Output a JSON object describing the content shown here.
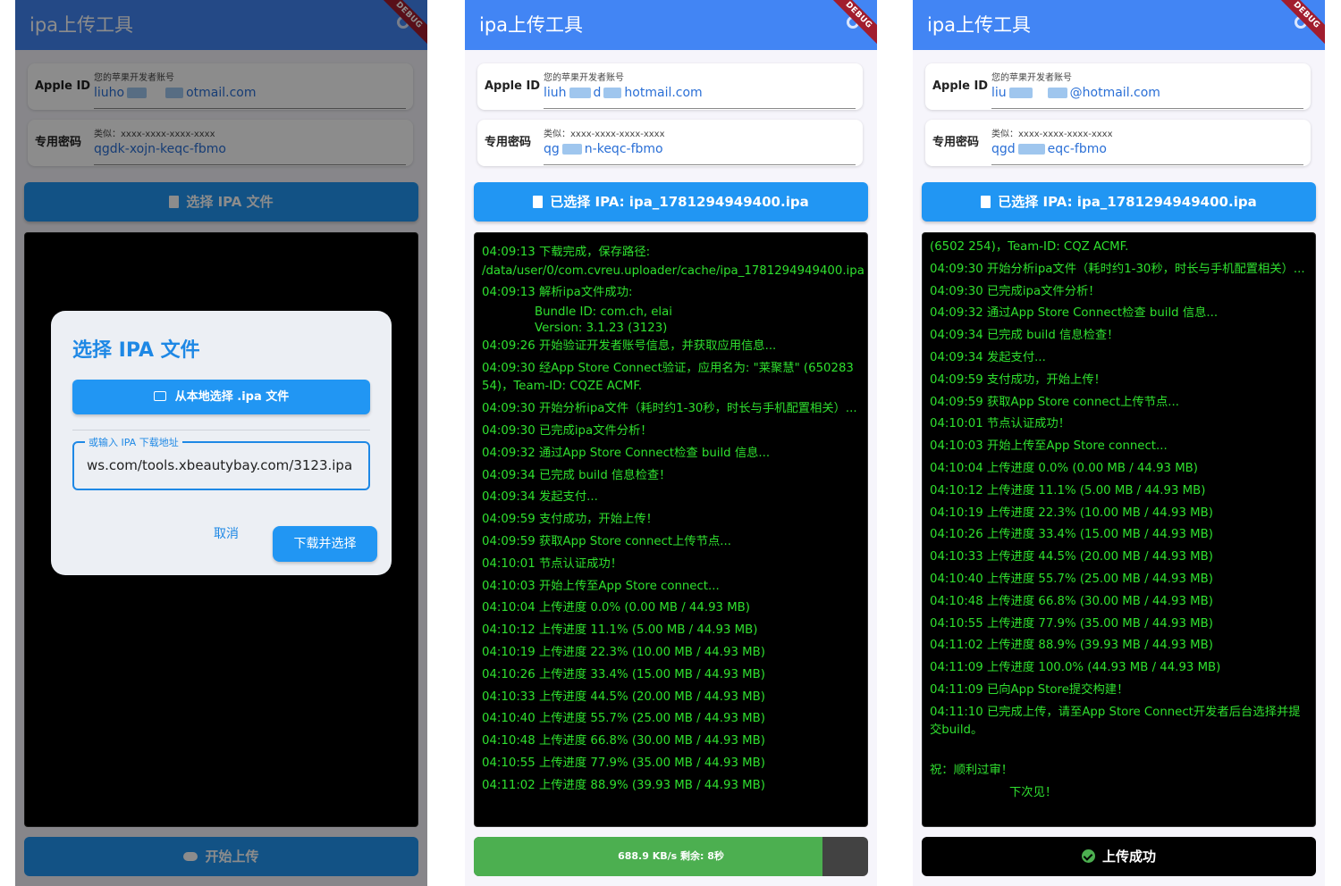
{
  "app": {
    "title": "ipa上传工具",
    "debug_label": "DEBUG"
  },
  "form": {
    "apple_id_label": "Apple ID",
    "apple_id_hint": "您的苹果开发者账号",
    "password_label": "专用密码",
    "password_hint": "类似：xxxx-xxxx-xxxx-xxxx"
  },
  "screen1": {
    "apple_id_a": "liuho",
    "apple_id_b": "otmail.com",
    "password_value": "qgdk-xojn-keqc-fbmo",
    "select_button": "选择 IPA 文件",
    "upload_button": "开始上传",
    "dialog": {
      "title": "选择 IPA 文件",
      "local_button": "从本地选择 .ipa 文件",
      "url_label": "或输入 IPA 下载地址",
      "url_value": "ws.com/tools.xbeautybay.com/3123.ipa",
      "cancel": "取消",
      "download": "下载并选择"
    }
  },
  "screen2": {
    "apple_id_a": "liuh",
    "apple_id_b": "d",
    "apple_id_c": "hotmail.com",
    "password_a": "qg",
    "password_b": "n-keqc-fbmo",
    "select_button": "已选择 IPA: ipa_1781294949400.ipa",
    "progress_text": "688.9 KB/s 剩余: 8秒",
    "progress_fraction": 0.885,
    "logs": [
      "04:09:13 下载完成，保存路径: /data/user/0/com.cvreu.uploader/cache/ipa_1781294949400.ipa",
      "04:09:13 解析ipa文件成功:",
      "Bundle ID: com.ch,   elai",
      "Version: 3.1.23 (3123)",
      "04:09:26 开始验证开发者账号信息，并获取应用信息...",
      "04:09:30 经App Store Connect验证，应用名为: \"莱聚慧\" (650283      54)，Team-ID: CQZE     ACMF.",
      "04:09:30 开始分析ipa文件（耗时约1-30秒，时长与手机配置相关）...",
      "04:09:30 已完成ipa文件分析！",
      "04:09:32 通过App Store Connect检查 build 信息...",
      "04:09:34 已完成 build 信息检查！",
      "04:09:34 发起支付...",
      "04:09:59 支付成功，开始上传！",
      "04:09:59 获取App Store connect上传节点...",
      "04:10:01 节点认证成功！",
      "04:10:03 开始上传至App Store connect...",
      "04:10:04 上传进度 0.0% (0.00 MB / 44.93 MB)",
      "04:10:12 上传进度 11.1% (5.00 MB / 44.93 MB)",
      "04:10:19 上传进度 22.3% (10.00 MB / 44.93 MB)",
      "04:10:26 上传进度 33.4% (15.00 MB / 44.93 MB)",
      "04:10:33 上传进度 44.5% (20.00 MB / 44.93 MB)",
      "04:10:40 上传进度 55.7% (25.00 MB / 44.93 MB)",
      "04:10:48 上传进度 66.8% (30.00 MB / 44.93 MB)",
      "04:10:55 上传进度 77.9% (35.00 MB / 44.93 MB)",
      "04:11:02 上传进度 88.9% (39.93 MB / 44.93 MB)"
    ]
  },
  "screen3": {
    "apple_id_a": "liu",
    "apple_id_c": "@hotmail.com",
    "password_a": "qgd",
    "password_b": "eqc-fbmo",
    "select_button": "已选择 IPA: ipa_1781294949400.ipa",
    "success_button": "上传成功",
    "logs": [
      "(6502      254)，Team-ID: CQZ      ACMF.",
      "04:09:30 开始分析ipa文件（耗时约1-30秒，时长与手机配置相关）...",
      "04:09:30 已完成ipa文件分析！",
      "04:09:32 通过App Store Connect检查 build 信息...",
      "04:09:34 已完成 build 信息检查！",
      "04:09:34 发起支付...",
      "04:09:59 支付成功，开始上传！",
      "04:09:59 获取App Store connect上传节点...",
      "04:10:01 节点认证成功！",
      "04:10:03 开始上传至App Store connect...",
      "04:10:04 上传进度 0.0% (0.00 MB / 44.93 MB)",
      "04:10:12 上传进度 11.1% (5.00 MB / 44.93 MB)",
      "04:10:19 上传进度 22.3% (10.00 MB / 44.93 MB)",
      "04:10:26 上传进度 33.4% (15.00 MB / 44.93 MB)",
      "04:10:33 上传进度 44.5% (20.00 MB / 44.93 MB)",
      "04:10:40 上传进度 55.7% (25.00 MB / 44.93 MB)",
      "04:10:48 上传进度 66.8% (30.00 MB / 44.93 MB)",
      "04:10:55 上传进度 77.9% (35.00 MB / 44.93 MB)",
      "04:11:02 上传进度 88.9% (39.93 MB / 44.93 MB)",
      "04:11:09 上传进度 100.0% (44.93 MB / 44.93 MB)",
      "04:11:09 已向App Store提交构建！",
      "04:11:10 已完成上传，请至App Store Connect开发者后台选择并提交build。",
      "",
      "祝：顺利过审！",
      "下次见！"
    ]
  },
  "colors": {
    "appbar": "#4285f4",
    "primary": "#2196f3",
    "console_text": "#2fe02f",
    "progress": "#4caf50",
    "debug": "#a11d2e"
  }
}
